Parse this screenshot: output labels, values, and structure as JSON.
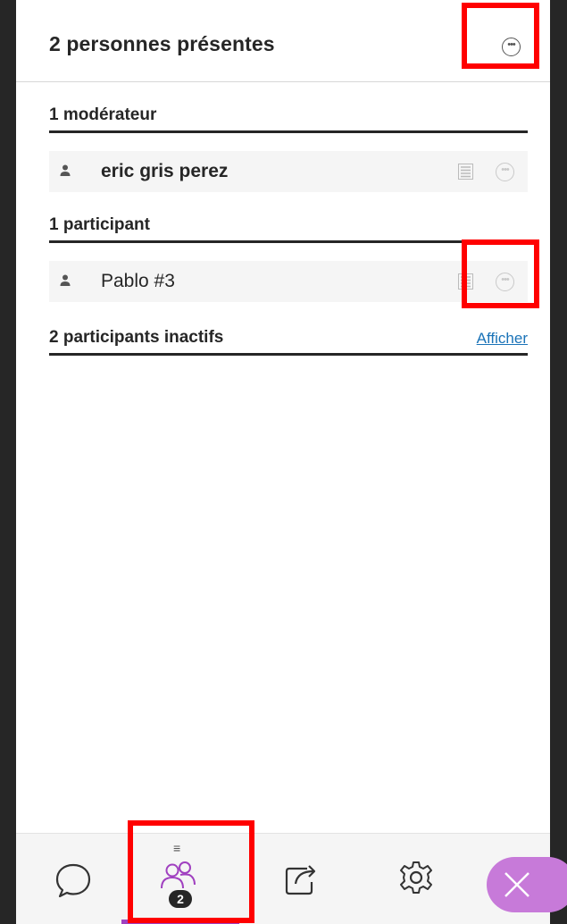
{
  "header": {
    "title": "2 personnes présentes",
    "more_icon": "more-options-icon"
  },
  "sections": {
    "moderators": {
      "label": "1 modérateur",
      "items": [
        {
          "name": "eric gris perez"
        }
      ]
    },
    "participants": {
      "label": "1 participant",
      "items": [
        {
          "name": "Pablo #3"
        }
      ]
    },
    "inactive": {
      "label": "2 participants inactifs",
      "link": "Afficher"
    }
  },
  "toolbar": {
    "items": [
      {
        "icon": "chat-icon"
      },
      {
        "icon": "participants-icon",
        "badge": "2",
        "active": true
      },
      {
        "icon": "share-icon"
      },
      {
        "icon": "gear-icon"
      },
      {
        "icon": "close-icon"
      }
    ]
  },
  "colors": {
    "accent": "#a040c0",
    "close_button": "#c77ad9",
    "highlight": "#ff0000",
    "link": "#1a73b8"
  }
}
